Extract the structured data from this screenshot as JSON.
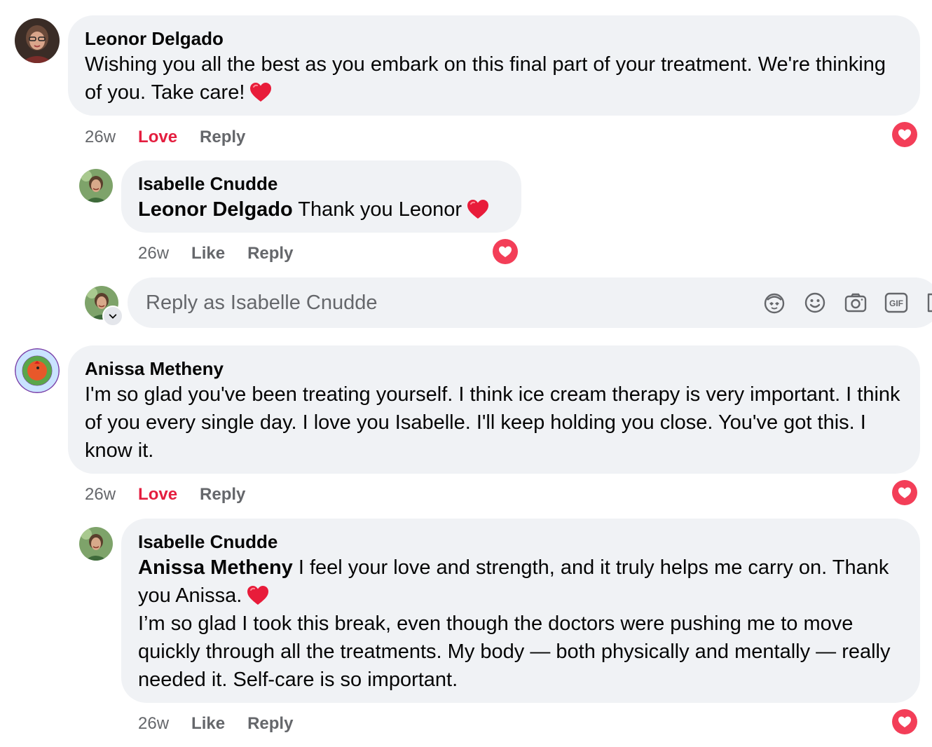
{
  "comments": [
    {
      "author": "Leonor Delgado",
      "text": "Wishing you all the best as you embark on this final part of your treatment. We're thinking of you. Take care!",
      "time": "26w",
      "reaction_label": "Love",
      "reply_label": "Reply",
      "reply": {
        "author": "Isabelle Cnudde",
        "mention": "Leonor Delgado",
        "text": " Thank you Leonor",
        "time": "26w",
        "like_label": "Like",
        "reply_label": "Reply"
      }
    },
    {
      "author": "Anissa Metheny",
      "text": "I'm so glad you've been treating yourself. I think ice cream therapy is very important. I think of you every single day. I love you Isabelle. I'll keep holding you close. You've got this. I know it.",
      "time": "26w",
      "reaction_label": "Love",
      "reply_label": "Reply",
      "reply": {
        "author": "Isabelle Cnudde",
        "mention": "Anissa Metheny",
        "text_1": " I feel your love and strength, and it truly helps me carry on. Thank you Anissa.",
        "text_2": "I’m so glad I took this break, even though the doctors were pushing me to move quickly through all the treatments. My body — both physically and mentally — really needed it. Self-care is so important.",
        "time": "26w",
        "like_label": "Like",
        "reply_label": "Reply"
      }
    }
  ],
  "reply_box": {
    "placeholder": "Reply as Isabelle Cnudde"
  },
  "icons": [
    "avatar-sticker-icon",
    "emoji-icon",
    "camera-icon",
    "gif-icon",
    "sticker-icon",
    "love-reaction-icon",
    "heart-emoji-icon"
  ],
  "colors": {
    "love": "#e41e3f",
    "bubble": "#f0f2f5",
    "meta": "#65676b"
  }
}
